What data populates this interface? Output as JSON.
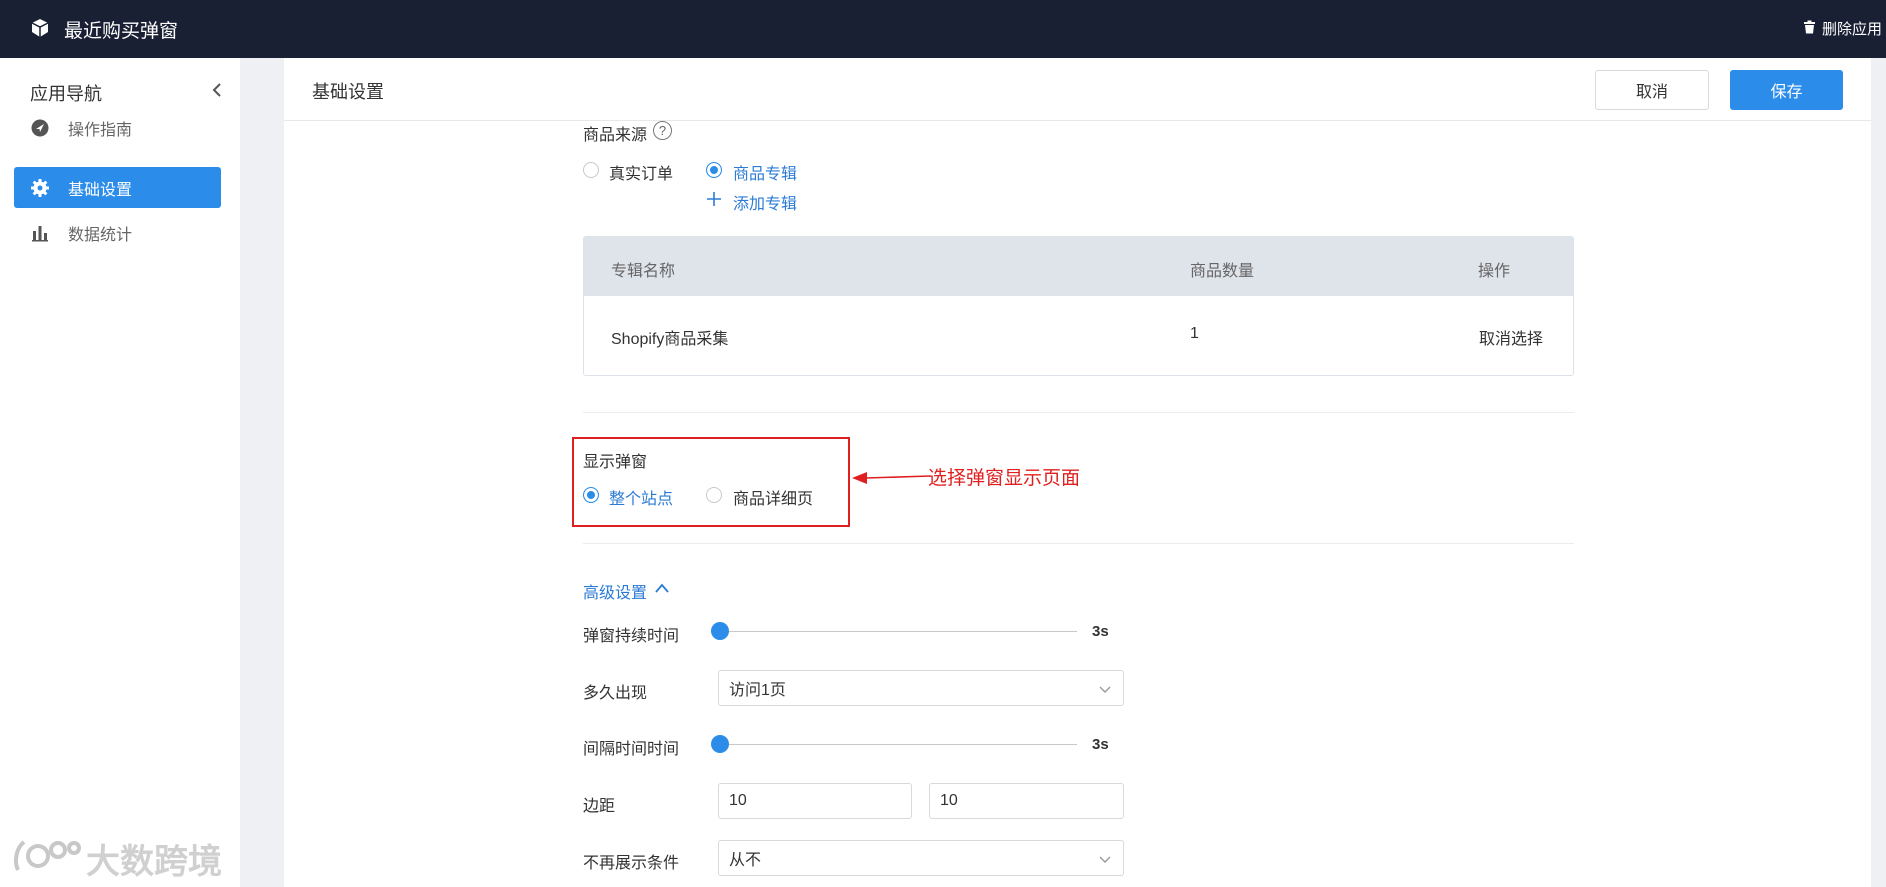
{
  "topbar": {
    "app_title": "最近购买弹窗",
    "delete_label": "删除应用"
  },
  "sidebar": {
    "header": "应用导航",
    "items": [
      {
        "label": "操作指南",
        "icon": "compass-icon",
        "active": false
      },
      {
        "label": "基础设置",
        "icon": "gear-icon",
        "active": true
      },
      {
        "label": "数据统计",
        "icon": "bar-chart-icon",
        "active": false
      }
    ]
  },
  "header": {
    "title": "基础设置",
    "cancel_label": "取消",
    "save_label": "保存"
  },
  "product_source": {
    "label": "商品来源",
    "help": "?",
    "options": [
      {
        "label": "真实订单",
        "checked": false
      },
      {
        "label": "商品专辑",
        "checked": true
      }
    ],
    "add_collection": "添加专辑"
  },
  "table": {
    "columns": [
      "专辑名称",
      "商品数量",
      "操作"
    ],
    "rows": [
      {
        "name": "Shopify商品采集",
        "count": "1",
        "action": "取消选择"
      }
    ]
  },
  "display_popup": {
    "label": "显示弹窗",
    "options": [
      {
        "label": "整个站点",
        "checked": true
      },
      {
        "label": "商品详细页",
        "checked": false
      }
    ]
  },
  "annotation": "选择弹窗显示页面",
  "advanced": {
    "toggle_label": "高级设置",
    "duration": {
      "label": "弹窗持续时间",
      "value": "3s",
      "fraction": 0
    },
    "frequency": {
      "label": "多久出现",
      "value": "访问1页"
    },
    "interval": {
      "label": "间隔时间时间",
      "value": "3s",
      "fraction": 0
    },
    "margin": {
      "label": "边距",
      "value1": "10",
      "value2": "10"
    },
    "no_show": {
      "label": "不再展示条件",
      "value": "从不"
    }
  },
  "watermark": "大数跨境",
  "colors": {
    "accent": "#2b8cea",
    "topbar": "#192034",
    "annotation": "#e02020"
  }
}
